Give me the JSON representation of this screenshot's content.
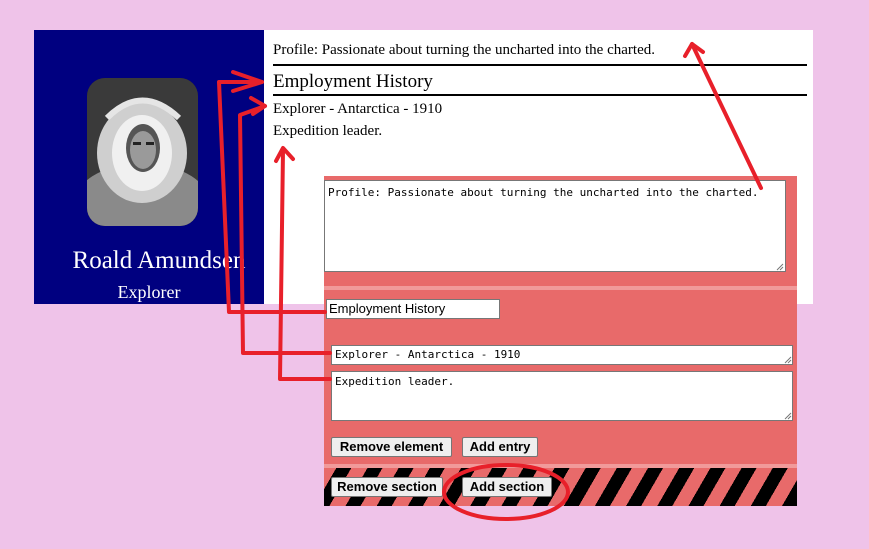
{
  "resume": {
    "name": "Roald Amundsen",
    "title": "Explorer",
    "profile": "Profile: Passionate about turning the uncharted into the charted.",
    "section_heading": "Employment History",
    "entry_title": "Explorer - Antarctica - 1910",
    "entry_description": "Expedition leader."
  },
  "editor": {
    "profile_text": "Profile: Passionate about turning the uncharted into the charted.",
    "section_title_value": "Employment History",
    "entry_title_value": "Explorer - Antarctica - 1910",
    "entry_description_value": "Expedition leader.",
    "remove_element_label": "Remove element",
    "add_entry_label": "Add entry",
    "remove_section_label": "Remove section",
    "add_section_label": "Add section"
  },
  "colors": {
    "sidebar": "#000080",
    "editor": "#e86a6a",
    "annotation": "#e8202a",
    "background": "#efc3e9"
  }
}
